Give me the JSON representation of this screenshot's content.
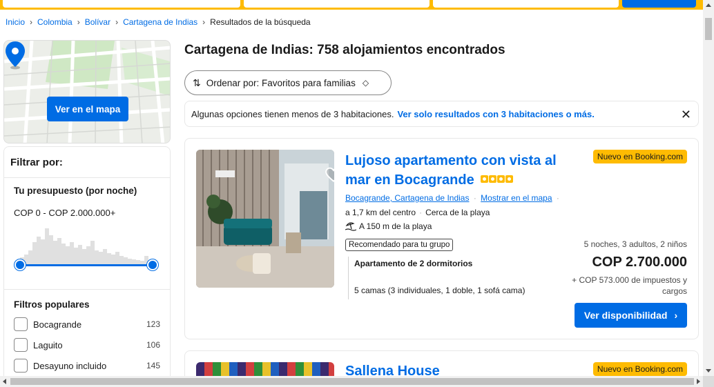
{
  "breadcrumb": {
    "items": [
      "Inicio",
      "Colombia",
      "Bolívar",
      "Cartagena de Indias"
    ],
    "current": "Resultados de la búsqueda"
  },
  "map": {
    "button_label": "Ver en el mapa"
  },
  "filters": {
    "title": "Filtrar por:",
    "budget_title": "Tu presupuesto (por noche)",
    "budget_range": "COP 0 - COP 2.000.000+",
    "popular_title": "Filtros populares",
    "popular": [
      {
        "label": "Bocagrande",
        "count": "123"
      },
      {
        "label": "Laguito",
        "count": "106"
      },
      {
        "label": "Desayuno incluido",
        "count": "145"
      }
    ]
  },
  "main": {
    "heading": "Cartagena de Indias: 758 alojamientos encontrados",
    "sort_label": "Ordenar por: Favoritos para familias",
    "notice_text": "Algunas opciones tienen menos de 3 habitaciones.",
    "notice_link": "Ver solo resultados con 3 habitaciones o más."
  },
  "listings": [
    {
      "title": "Lujoso apartamento con vista al mar en Bocagrande",
      "stars": 4,
      "badge": "Nuevo en Booking.com",
      "location_link": "Bocagrande, Cartagena de Indias",
      "map_link": "Mostrar en el mapa",
      "distance": "a 1,7 km del centro",
      "beach_near": "Cerca de la playa",
      "beach_distance": "A 150 m de la playa",
      "recommended": "Recomendado para tu grupo",
      "unit_name": "Apartamento de 2 dormitorios",
      "beds": "5 camas (3 individuales, 1 doble, 1 sofá cama)",
      "stay": "5 noches, 3 adultos, 2 niños",
      "price": "COP 2.700.000",
      "taxes": "+ COP 573.000 de impuestos y cargos",
      "cta": "Ver disponibilidad"
    },
    {
      "title": "Sallena House",
      "badge": "Nuevo en Booking.com"
    }
  ],
  "colors": {
    "brand_blue": "#006ce4",
    "yellow": "#febb02"
  }
}
